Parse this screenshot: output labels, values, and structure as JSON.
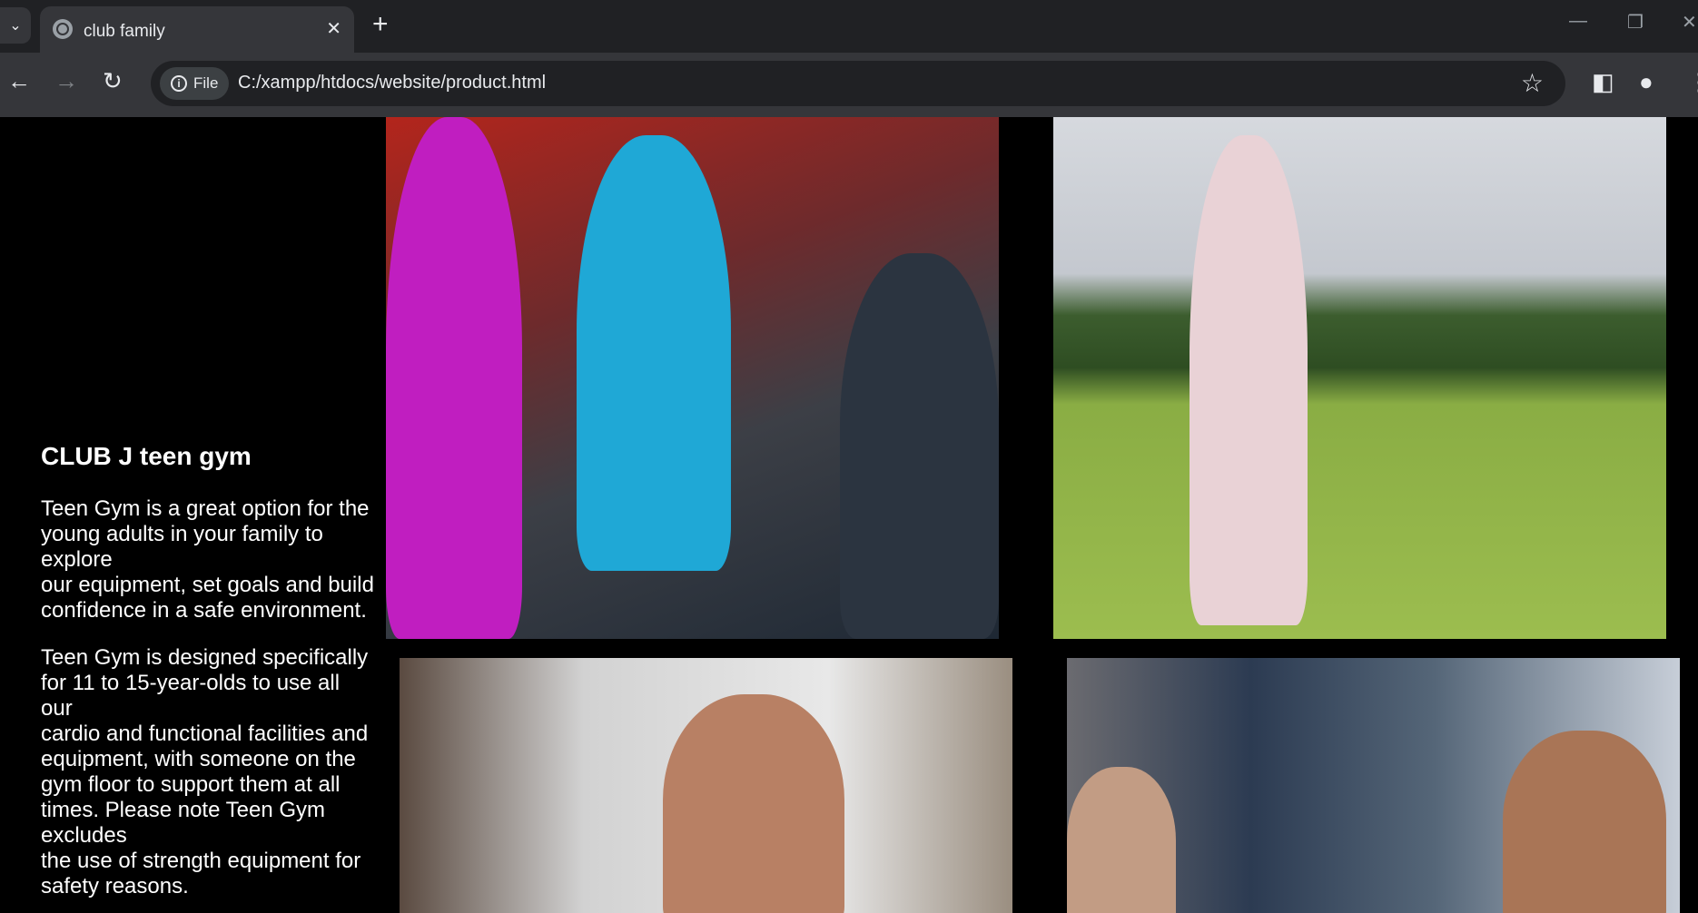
{
  "browser": {
    "tab_title": "club family",
    "new_tab_label": "+",
    "close_label": "✕",
    "tab_list_label": "⌄",
    "file_chip_label": "File",
    "url": "C:/xampp/htdocs/website/product.html"
  },
  "page": {
    "heading": "CLUB J teen gym",
    "paragraphs": [
      "Teen Gym is a great option for the young adults in your family to explore\nour equipment, set goals and build confidence in a safe environment.",
      "Teen Gym is designed specifically for 11 to 15-year-olds to use all our\ncardio and functional facilities and equipment, with someone on the gym floor to support them at all times. Please note Teen Gym excludes\nthe use of strength equipment for safety reasons."
    ]
  },
  "colors": {
    "page_background": "#000000",
    "tab_strip": "#202124",
    "toolbar": "#35363a"
  }
}
